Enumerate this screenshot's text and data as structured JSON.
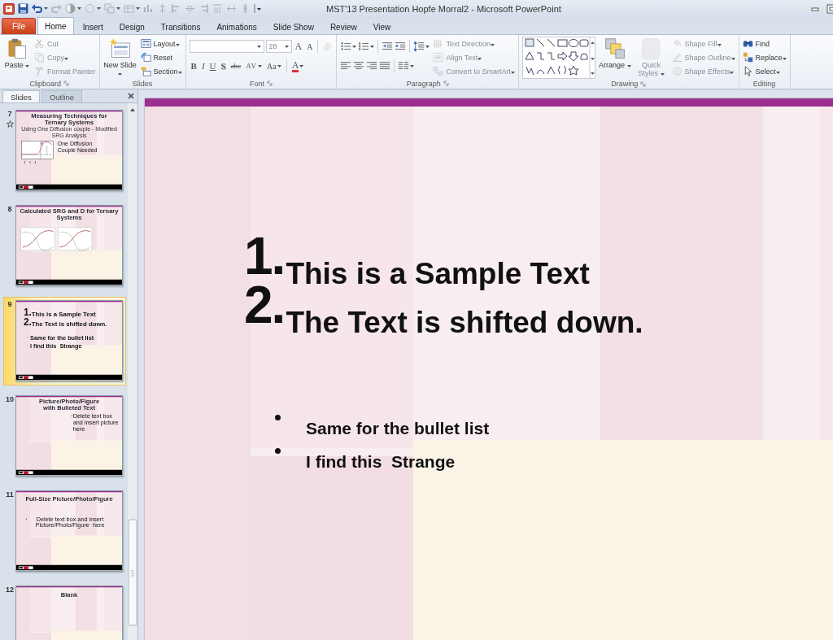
{
  "window": {
    "title": "MST'13 Presentation Hopfe Morral2 - Microsoft PowerPoint"
  },
  "tabs": [
    {
      "label": "File",
      "kind": "file",
      "selected": false
    },
    {
      "label": "Home",
      "kind": "tab",
      "selected": true
    },
    {
      "label": "Insert",
      "kind": "tab",
      "selected": false
    },
    {
      "label": "Design",
      "kind": "tab",
      "selected": false
    },
    {
      "label": "Transitions",
      "kind": "tab",
      "selected": false
    },
    {
      "label": "Animations",
      "kind": "tab",
      "selected": false
    },
    {
      "label": "Slide Show",
      "kind": "tab",
      "selected": false
    },
    {
      "label": "Review",
      "kind": "tab",
      "selected": false
    },
    {
      "label": "View",
      "kind": "tab",
      "selected": false
    }
  ],
  "ribbon_groups": [
    {
      "label": "Clipboard",
      "launcher": true,
      "columns": [
        [
          {
            "kind": "large",
            "label": "Paste",
            "dropdown": true,
            "disabled": false
          }
        ],
        [
          {
            "kind": "small",
            "label": "Cut",
            "dropdown": false,
            "disabled": true
          },
          {
            "kind": "small",
            "label": "Copy",
            "dropdown": true,
            "disabled": true
          },
          {
            "kind": "small",
            "label": "Format Painter",
            "dropdown": false,
            "disabled": true
          }
        ]
      ]
    },
    {
      "label": "Slides",
      "launcher": false,
      "columns": [
        [
          {
            "kind": "large",
            "label": "New Slide",
            "dropdown": true,
            "disabled": false
          }
        ],
        [
          {
            "kind": "small",
            "label": "Layout",
            "dropdown": true,
            "disabled": false
          },
          {
            "kind": "small",
            "label": "Reset",
            "dropdown": false,
            "disabled": false
          },
          {
            "kind": "small",
            "label": "Section",
            "dropdown": true,
            "disabled": false
          }
        ]
      ]
    },
    {
      "label": "Font",
      "launcher": true,
      "columns": [
        [
          {
            "kind": "row",
            "items": [
              {
                "kind": "font-field",
                "dropdown": true
              },
              {
                "kind": "size-field",
                "value": "28",
                "dropdown": true
              },
              {
                "kind": "glyph",
                "label": "A",
                "dropdown": false,
                "disabled": false
              },
              {
                "kind": "glyph",
                "label": "A",
                "dropdown": false,
                "disabled": false
              },
              {
                "kind": "separator"
              },
              {
                "kind": "icon",
                "dropdown": false,
                "disabled": true
              }
            ]
          },
          {
            "kind": "row",
            "items": [
              {
                "kind": "glyph",
                "label": "B",
                "dropdown": false,
                "disabled": false
              },
              {
                "kind": "glyph",
                "label": "I",
                "dropdown": false,
                "disabled": false
              },
              {
                "kind": "glyph",
                "label": "U",
                "dropdown": false,
                "disabled": false
              },
              {
                "kind": "glyph",
                "label": "S",
                "dropdown": false,
                "disabled": false
              },
              {
                "kind": "glyph",
                "label": "abc",
                "dropdown": false,
                "disabled": false
              },
              {
                "kind": "glyph",
                "label": "AV",
                "dropdown": true,
                "disabled": false
              },
              {
                "kind": "glyph",
                "label": "Aa",
                "dropdown": true,
                "disabled": false
              },
              {
                "kind": "separator"
              },
              {
                "kind": "glyph",
                "label": "A",
                "dropdown": true,
                "disabled": false
              }
            ]
          }
        ]
      ]
    },
    {
      "label": "Paragraph",
      "launcher": true,
      "columns": [
        [
          {
            "kind": "row",
            "items": [
              {
                "kind": "icon",
                "dropdown": true,
                "disabled": false
              },
              {
                "kind": "icon",
                "dropdown": true,
                "disabled": false
              },
              {
                "kind": "separator"
              },
              {
                "kind": "icon",
                "dropdown": false,
                "disabled": false
              },
              {
                "kind": "icon",
                "dropdown": false,
                "disabled": false
              },
              {
                "kind": "separator"
              },
              {
                "kind": "icon",
                "dropdown": true,
                "disabled": false
              }
            ]
          },
          {
            "kind": "row",
            "items": [
              {
                "kind": "icon",
                "dropdown": false,
                "disabled": false
              },
              {
                "kind": "icon",
                "dropdown": false,
                "disabled": false
              },
              {
                "kind": "icon",
                "dropdown": false,
                "disabled": false
              },
              {
                "kind": "icon",
                "dropdown": false,
                "disabled": false
              },
              {
                "kind": "separator"
              },
              {
                "kind": "icon",
                "dropdown": true,
                "disabled": false
              }
            ]
          }
        ],
        [
          {
            "kind": "small",
            "label": "Text Direction",
            "dropdown": true,
            "disabled": true
          },
          {
            "kind": "small",
            "label": "Align Text",
            "dropdown": true,
            "disabled": true
          },
          {
            "kind": "small",
            "label": "Convert to SmartArt",
            "dropdown": true,
            "disabled": true
          }
        ]
      ]
    },
    {
      "label": "Drawing",
      "launcher": true,
      "columns": [
        [
          {
            "kind": "gallery"
          }
        ],
        [
          {
            "kind": "large",
            "label": "Arrange",
            "dropdown": true,
            "disabled": false
          }
        ],
        [
          {
            "kind": "large",
            "label": "Quick Styles",
            "dropdown": true,
            "disabled": true
          }
        ],
        [
          {
            "kind": "small",
            "label": "Shape Fill",
            "dropdown": true,
            "disabled": true
          },
          {
            "kind": "small",
            "label": "Shape Outline",
            "dropdown": true,
            "disabled": true
          },
          {
            "kind": "small",
            "label": "Shape Effects",
            "dropdown": true,
            "disabled": true
          }
        ]
      ]
    },
    {
      "label": "Editing",
      "launcher": false,
      "columns": [
        [
          {
            "kind": "small",
            "label": "Find",
            "dropdown": false,
            "disabled": false
          },
          {
            "kind": "small",
            "label": "Replace",
            "dropdown": true,
            "disabled": false
          },
          {
            "kind": "small",
            "label": "Select",
            "dropdown": true,
            "disabled": false
          }
        ]
      ]
    }
  ],
  "slides_pane": {
    "tabs": [
      {
        "label": "Slides",
        "selected": true
      },
      {
        "label": "Outline",
        "selected": false
      }
    ],
    "slides": [
      {
        "number": "7",
        "selected": false,
        "animated": true,
        "kind": "chart",
        "title": "Measuring Techniques for Ternary Systems",
        "subtitle": "Using One Diffusion couple - Modified SRG Analysis",
        "note": "One Diffusion Couple Needed"
      },
      {
        "number": "8",
        "selected": false,
        "animated": false,
        "kind": "two-charts",
        "title": "Calculated SRG and D for Ternary Systems"
      },
      {
        "number": "9",
        "selected": true,
        "animated": false,
        "kind": "list",
        "numbered": [
          {
            "number": "1.",
            "text": "This is a Sample Text"
          },
          {
            "number": "2.",
            "text": "The Text is shifted down."
          }
        ],
        "bullets": [
          "Same for the bullet list",
          "I find this  Strange"
        ]
      },
      {
        "number": "10",
        "selected": false,
        "animated": false,
        "kind": "picture-text",
        "title": "Picture/Photo/Figure with Bulleted Text",
        "body": "Delete text box and insert picture here"
      },
      {
        "number": "11",
        "selected": false,
        "animated": false,
        "kind": "full-picture",
        "title": "Full-Size Picture/Photo/Figure",
        "body": "Delete text box and insert Picture/Photo/Figure  here"
      },
      {
        "number": "12",
        "selected": false,
        "animated": false,
        "kind": "blank",
        "title": "Blank"
      }
    ]
  },
  "slide": {
    "kind": "list",
    "numbered": [
      {
        "number": "1.",
        "text": "This is a Sample Text"
      },
      {
        "number": "2.",
        "text": "The Text is shifted down."
      }
    ],
    "bullets": [
      "Same for the bullet list",
      "I find this  Strange"
    ]
  }
}
